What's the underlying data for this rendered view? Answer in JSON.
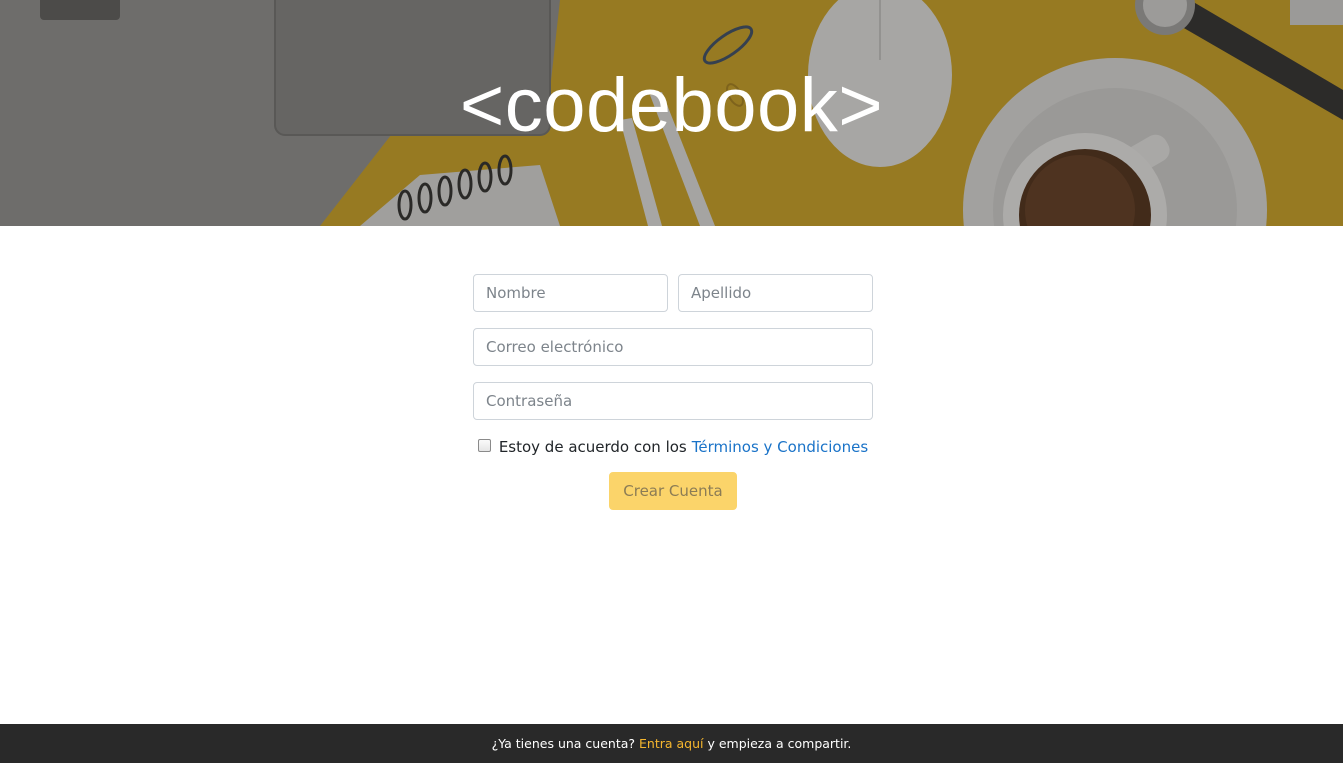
{
  "hero": {
    "title": "<codebook>"
  },
  "form": {
    "first_name_placeholder": "Nombre",
    "last_name_placeholder": "Apellido",
    "email_placeholder": "Correo electrónico",
    "password_placeholder": "Contraseña",
    "terms_text": "Estoy de acuerdo con los",
    "terms_link": "Términos y Condiciones",
    "terms_checked": false,
    "submit_label": "Crear Cuenta"
  },
  "footer": {
    "prefix": "¿Ya tienes una cuenta? ",
    "link": "Entra aquí",
    "suffix": " y empieza a compartir."
  },
  "colors": {
    "accent_yellow": "#fbd46a",
    "link_blue": "#1a73c8",
    "footer_bg": "#292929",
    "footer_link": "#f5b62e"
  }
}
